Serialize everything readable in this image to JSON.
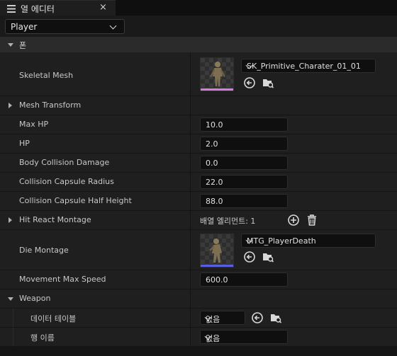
{
  "tab": {
    "title": "열 에디터",
    "close": "×"
  },
  "actor_select": {
    "value": "Player"
  },
  "category_pawn": {
    "label": "폰"
  },
  "skeletal_mesh": {
    "label": "Skeletal Mesh",
    "asset": "SK_Primitive_Charater_01_01",
    "bar_color": "#d77be0"
  },
  "mesh_transform": {
    "label": "Mesh Transform"
  },
  "max_hp": {
    "label": "Max HP",
    "value": "10.0"
  },
  "hp": {
    "label": "HP",
    "value": "2.0"
  },
  "body_collision_damage": {
    "label": "Body Collision Damage",
    "value": "0.0"
  },
  "capsule_radius": {
    "label": "Collision Capsule Radius",
    "value": "22.0"
  },
  "capsule_half_height": {
    "label": "Collision Capsule Half Height",
    "value": "88.0"
  },
  "hit_react_montage": {
    "label": "Hit React Montage",
    "array_text": "배열 엘리먼트: 1"
  },
  "die_montage": {
    "label": "Die Montage",
    "asset": "MTG_PlayerDeath",
    "bar_color": "#5a5ee0"
  },
  "movement_max_speed": {
    "label": "Movement Max Speed",
    "value": "600.0"
  },
  "weapon": {
    "label": "Weapon"
  },
  "data_table": {
    "label": "데이터 테이블",
    "value": "없음"
  },
  "row_name": {
    "label": "행 이름",
    "value": "없음"
  },
  "icons": [
    "close-icon",
    "chevron-down-icon",
    "collapse-arrow-icon",
    "expand-arrow-icon",
    "use-selected-icon",
    "browse-folder-icon",
    "add-element-icon",
    "trash-icon"
  ]
}
